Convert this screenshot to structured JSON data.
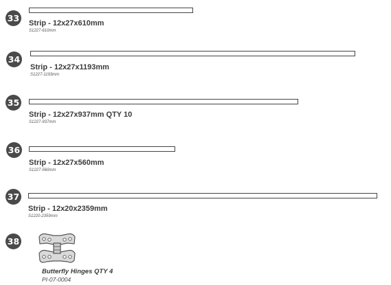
{
  "items": [
    {
      "number": "33",
      "name": "Strip - 12x27x610mm",
      "code": "S1227-610mm"
    },
    {
      "number": "34",
      "name": "Strip - 12x27x1193mm",
      "code": "S1227-1193mm"
    },
    {
      "number": "35",
      "name": "Strip - 12x27x937mm QTY 10",
      "code": "S1227-937mm"
    },
    {
      "number": "36",
      "name": "Strip - 12x27x560mm",
      "code": "S1227-560mm"
    },
    {
      "number": "37",
      "name": "Strip - 12x20x2359mm",
      "code": "S1220-2359mm"
    },
    {
      "number": "38",
      "name": "Butterfly Hinges QTY 4",
      "code": "PI-07-0004",
      "icon": "butterfly-hinge-icon"
    }
  ]
}
